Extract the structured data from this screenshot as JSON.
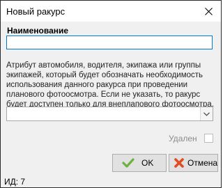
{
  "window": {
    "title": "Новый ракурс"
  },
  "form": {
    "name_label": "Наименование",
    "name_value": "",
    "description": "Атрибут автомобиля, водителя, экипажа или группы экипажей, который будет обозначать необходимость использования данного ракурса при проведении планового фотоосмотра. Если не указать, то ракурс будет доступен только для внеплапового фотоосмотра.",
    "attribute_selected": "",
    "deleted_label": "Удален",
    "deleted_checked": false
  },
  "buttons": {
    "ok_label": "OK",
    "cancel_label": "Отмена"
  },
  "status": {
    "text": "ИД: 7"
  },
  "colors": {
    "ok_icon": "#6bb33c",
    "cancel_icon": "#e24a1f",
    "focus_border": "#0078d7"
  }
}
